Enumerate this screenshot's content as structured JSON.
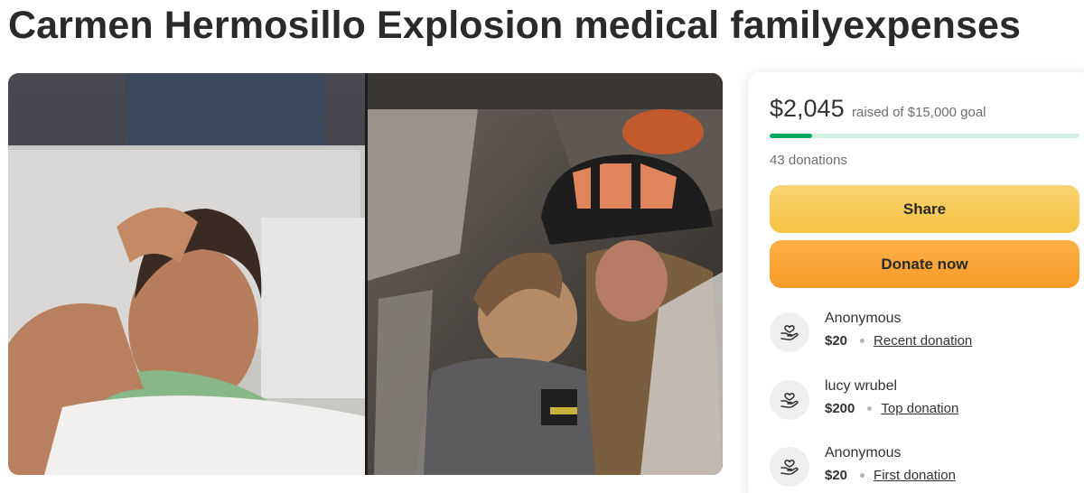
{
  "page": {
    "title": "Carmen Hermosillo Explosion medical familyexpenses"
  },
  "hero": {
    "icon": "campaign-photo"
  },
  "fundraiser": {
    "raised_amount": "$2,045",
    "goal_text": "raised of $15,000 goal",
    "progress_fraction": 0.136,
    "donations_count": "43 donations",
    "share_label": "Share",
    "donate_label": "Donate now"
  },
  "donors": [
    {
      "name": "Anonymous",
      "amount": "$20",
      "tag": "Recent donation",
      "icon": "heart-hand-icon"
    },
    {
      "name": "lucy wrubel",
      "amount": "$200",
      "tag": "Top donation",
      "icon": "heart-hand-icon"
    },
    {
      "name": "Anonymous",
      "amount": "$20",
      "tag": "First donation",
      "icon": "heart-hand-icon"
    }
  ],
  "colors": {
    "progress": "#02a95c",
    "progress_track": "#d4f0e3",
    "share_button": "#f6c344",
    "donate_button": "#f89b29"
  }
}
